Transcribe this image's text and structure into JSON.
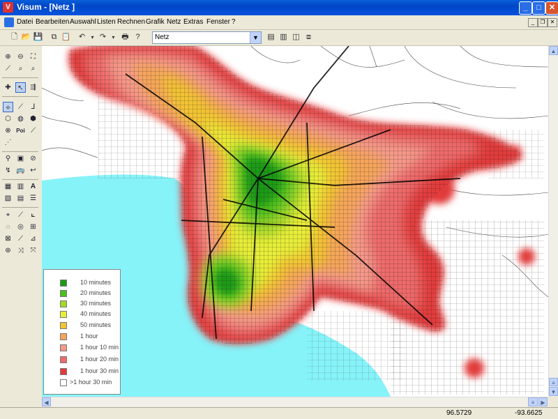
{
  "window": {
    "title": "Visum - [Netz ]",
    "icon_letter": "V",
    "min_label": "_",
    "max_label": "□",
    "close_label": "✕"
  },
  "menu": {
    "items": [
      "Datei",
      "Bearbeiten",
      "Auswahl",
      "Listen",
      "Rechnen",
      "Grafik",
      "Netz",
      "Extras",
      "Fenster",
      "?"
    ]
  },
  "toolbar": {
    "network_select_value": "Netz"
  },
  "legend": {
    "items": [
      {
        "label": "10 minutes",
        "color": "#1f9a17"
      },
      {
        "label": "20 minutes",
        "color": "#4cbf1e"
      },
      {
        "label": "30 minutes",
        "color": "#a4d82a"
      },
      {
        "label": "40 minutes",
        "color": "#e8ee38"
      },
      {
        "label": "50 minutes",
        "color": "#f2c433"
      },
      {
        "label": "1 hour",
        "color": "#f5a558"
      },
      {
        "label": "1 hour 10 min",
        "color": "#f59a8a"
      },
      {
        "label": "1 hour 20 min",
        "color": "#ee6b6b"
      },
      {
        "label": "1 hour 30 min",
        "color": "#e23a3a"
      },
      {
        "label": ">1 hour 30 min",
        "color": "#ffffff"
      }
    ]
  },
  "statusbar": {
    "x": "96.5729",
    "y": "-93.6625"
  },
  "colors": {
    "water": "#86f3f9",
    "accent": "#0553de"
  }
}
